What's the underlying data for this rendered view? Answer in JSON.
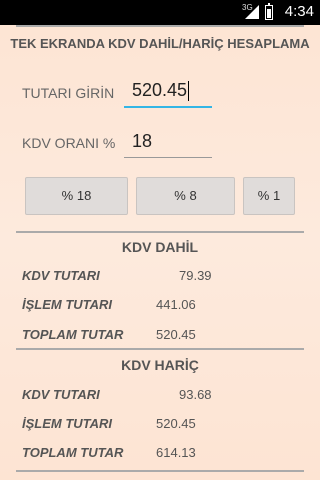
{
  "status_bar": {
    "network": "3G",
    "time": "4:34"
  },
  "title": "TEK EKRANDA KDV DAHİL/HARİÇ HESAPLAMA",
  "inputs": {
    "amount_label": "TUTARI GİRİN",
    "amount_value": "520.45",
    "rate_label": "KDV ORANI %",
    "rate_value": "18"
  },
  "buttons": {
    "rate18": "% 18",
    "rate8": "% 8",
    "rate1": "% 1"
  },
  "kdv_dahil": {
    "title": "KDV DAHİL",
    "rows": [
      {
        "label": "KDV TUTARI",
        "value": "79.39"
      },
      {
        "label": "İŞLEM TUTARI",
        "value": "441.06"
      },
      {
        "label": "TOPLAM TUTAR",
        "value": "520.45"
      }
    ]
  },
  "kdv_haric": {
    "title": "KDV HARİÇ",
    "rows": [
      {
        "label": "KDV TUTARI",
        "value": "93.68"
      },
      {
        "label": "İŞLEM TUTARI",
        "value": "520.45"
      },
      {
        "label": "TOPLAM TUTAR",
        "value": "614.13"
      }
    ]
  }
}
